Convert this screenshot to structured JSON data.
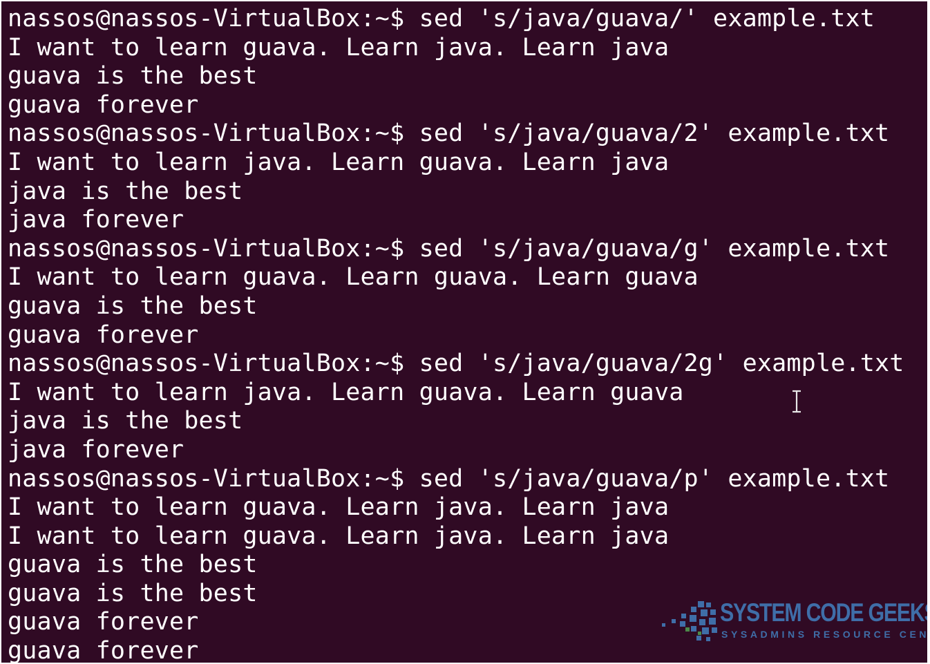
{
  "terminal": {
    "background_color": "#300a24",
    "text_color": "#ffffff",
    "lines": [
      "nassos@nassos-VirtualBox:~$ sed 's/java/guava/' example.txt",
      "I want to learn guava. Learn java. Learn java",
      "guava is the best",
      "guava forever",
      "nassos@nassos-VirtualBox:~$ sed 's/java/guava/2' example.txt",
      "I want to learn java. Learn guava. Learn java",
      "java is the best",
      "java forever",
      "nassos@nassos-VirtualBox:~$ sed 's/java/guava/g' example.txt",
      "I want to learn guava. Learn guava. Learn guava",
      "guava is the best",
      "guava forever",
      "nassos@nassos-VirtualBox:~$ sed 's/java/guava/2g' example.txt",
      "I want to learn java. Learn guava. Learn guava",
      "java is the best",
      "java forever",
      "nassos@nassos-VirtualBox:~$ sed 's/java/guava/p' example.txt",
      "I want to learn guava. Learn java. Learn java",
      "I want to learn guava. Learn java. Learn java",
      "guava is the best",
      "guava is the best",
      "guava forever",
      "guava forever"
    ],
    "cursor_icon": "text-cursor-icon"
  },
  "watermark": {
    "title": "SYSTEM CODE GEEKS",
    "subtitle": "SYSADMINS RESOURCE CENTER",
    "logo_icon": "scattered-squares-logo-icon",
    "color": "#3f6ea8"
  }
}
